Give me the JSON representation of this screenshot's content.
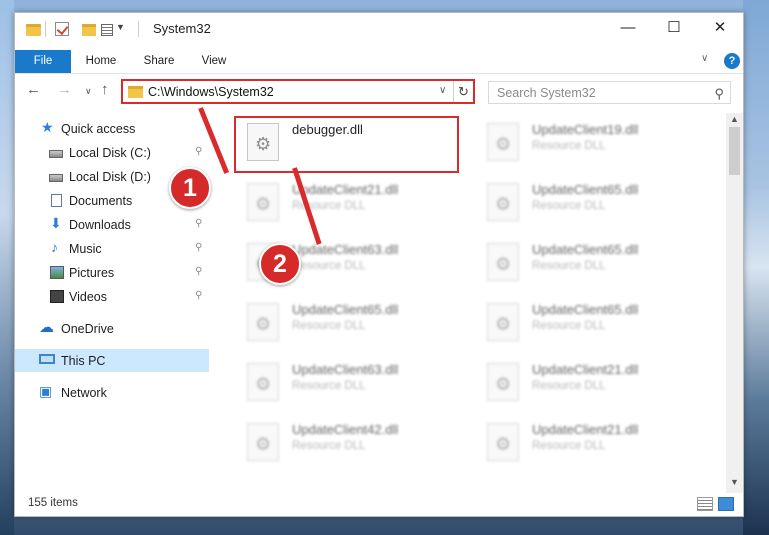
{
  "window": {
    "title": "System32"
  },
  "ribbon": {
    "tabs": [
      "File",
      "Home",
      "Share",
      "View"
    ],
    "help": "?"
  },
  "address": {
    "path": "C:\\Windows\\System32"
  },
  "search": {
    "placeholder": "Search System32"
  },
  "sidebar": {
    "items": [
      {
        "label": "Quick access",
        "icon": "star-icon"
      },
      {
        "label": "Local Disk (C:)",
        "icon": "disk-icon",
        "pinned": true
      },
      {
        "label": "Local Disk (D:)",
        "icon": "disk-icon"
      },
      {
        "label": "Documents",
        "icon": "documents-icon",
        "pinned": true
      },
      {
        "label": "Downloads",
        "icon": "download-icon",
        "pinned": true
      },
      {
        "label": "Music",
        "icon": "music-icon",
        "pinned": true
      },
      {
        "label": "Pictures",
        "icon": "pictures-icon",
        "pinned": true
      },
      {
        "label": "Videos",
        "icon": "videos-icon",
        "pinned": true
      },
      {
        "label": "OneDrive",
        "icon": "onedrive-icon"
      },
      {
        "label": "This PC",
        "icon": "pc-icon",
        "selected": true
      },
      {
        "label": "Network",
        "icon": "network-icon"
      }
    ]
  },
  "files": [
    {
      "name": "debugger.dll",
      "desc": ""
    },
    {
      "name": "UpdateClient19.dll",
      "desc": "Resource DLL"
    },
    {
      "name": "UpdateClient21.dll",
      "desc": "Resource DLL"
    },
    {
      "name": "UpdateClient65.dll",
      "desc": "Resource DLL"
    },
    {
      "name": "UpdateClient63.dll",
      "desc": "Resource DLL"
    },
    {
      "name": "UpdateClient65.dll",
      "desc": "Resource DLL"
    },
    {
      "name": "UpdateClient65.dll",
      "desc": "Resource DLL"
    },
    {
      "name": "UpdateClient65.dll",
      "desc": "Resource DLL"
    },
    {
      "name": "UpdateClient63.dll",
      "desc": "Resource DLL"
    },
    {
      "name": "UpdateClient21.dll",
      "desc": "Resource DLL"
    },
    {
      "name": "UpdateClient42.dll",
      "desc": "Resource DLL"
    },
    {
      "name": "UpdateClient21.dll",
      "desc": "Resource DLL"
    }
  ],
  "status": {
    "count": "155 items"
  },
  "annotations": {
    "badge1": "1",
    "badge2": "2"
  },
  "colors": {
    "accent": "#1979ca",
    "highlight": "#d92b2b"
  }
}
